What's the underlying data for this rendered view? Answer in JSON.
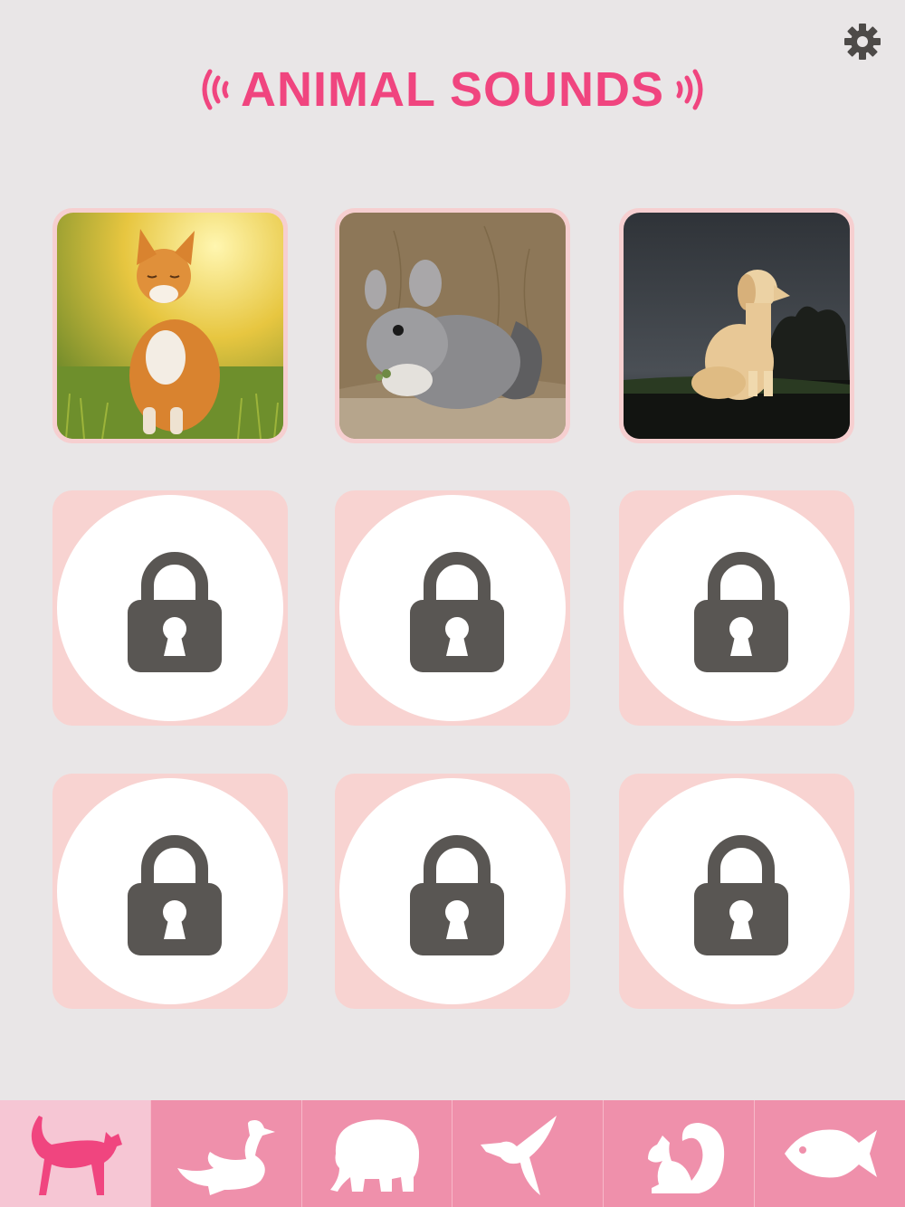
{
  "header": {
    "title": "ANIMAL SOUNDS",
    "title_color": "#f0457f",
    "settings_icon": "gear-icon"
  },
  "animals": [
    {
      "name": "cat",
      "state": "unlocked"
    },
    {
      "name": "chinchilla",
      "state": "unlocked"
    },
    {
      "name": "dog",
      "state": "unlocked"
    },
    {
      "state": "locked"
    },
    {
      "state": "locked"
    },
    {
      "state": "locked"
    },
    {
      "state": "locked"
    },
    {
      "state": "locked"
    },
    {
      "state": "locked"
    }
  ],
  "lock_icon": "lock-icon",
  "tabs": [
    {
      "icon": "cat-icon",
      "active": true
    },
    {
      "icon": "duck-icon",
      "active": false
    },
    {
      "icon": "elephant-icon",
      "active": false
    },
    {
      "icon": "bird-icon",
      "active": false
    },
    {
      "icon": "squirrel-icon",
      "active": false
    },
    {
      "icon": "fish-icon",
      "active": false
    }
  ],
  "colors": {
    "background": "#e9e6e7",
    "accent": "#f0457f",
    "tile_pink": "#f8d3d1",
    "tabbar": "#ef90ab",
    "tab_active": "#f6c6d4",
    "lock_gray": "#595653"
  }
}
